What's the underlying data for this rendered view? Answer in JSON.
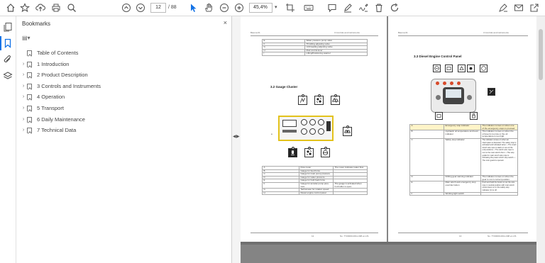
{
  "toolbar": {
    "current_page": "12",
    "total_pages": "/ 88",
    "zoom": "45,4%",
    "icons": [
      "home-icon",
      "star-icon",
      "upload-icon",
      "print-icon",
      "zoom-search-icon",
      "prev-page-icon",
      "next-page-icon",
      "select-cursor-icon",
      "hand-tool-icon",
      "zoom-out-icon",
      "zoom-in-icon",
      "crop-icon",
      "keyboard-icon",
      "comment-icon",
      "highlight-pen-icon",
      "sign-icon",
      "delete-icon",
      "rotate-icon",
      "redact-icon",
      "mail-icon",
      "share-icon"
    ]
  },
  "left_rail": {
    "icons": [
      "copy-pages-icon",
      "bookmark-icon",
      "attachment-icon",
      "layers-icon"
    ]
  },
  "bookmarks_panel": {
    "title": "Bookmarks",
    "close": "×",
    "options": "▤▾",
    "items": [
      {
        "label": "Table of Contents",
        "expandable": false
      },
      {
        "label": "1 Introduction",
        "expandable": true
      },
      {
        "label": "2 Product Description",
        "expandable": true
      },
      {
        "label": "3 Controls and Instruments",
        "expandable": true
      },
      {
        "label": "4 Operation",
        "expandable": true
      },
      {
        "label": "5 Transport",
        "expandable": true
      },
      {
        "label": "6 Daily Maintenance",
        "expandable": true
      },
      {
        "label": "7 Technical Data",
        "expandable": true
      }
    ]
  },
  "splitter": {
    "left_arrow": "◀",
    "right_arrow": "▶"
  },
  "page_left": {
    "header_left": "Bauma 01",
    "header_right": "3 Controls and instruments",
    "top_table": [
      [
        "E",
        "Water pressure pump valve"
      ],
      [
        "F",
        "Throttling adjusting valve"
      ],
      [
        "G",
        "Unthreading adjusting valve"
      ],
      [
        "H",
        "Mud control lever"
      ],
      [
        "I",
        "Lifting/Positioning swarrel"
      ]
    ],
    "section_title": "3.2   Gauge Cluster",
    "label_a": "a",
    "gauge_table": [
      [
        "A",
        "Flow meter",
        "The meter indicates water flow."
      ],
      [
        "B",
        "Gauge for feed force",
        ""
      ],
      [
        "C",
        "Gauge for main pump pressure",
        ""
      ],
      [
        "D",
        "Gauge for water pressure",
        ""
      ],
      [
        "E",
        "Gauge for hold back force",
        ""
      ],
      [
        "F",
        "Gauge for annular pump pres-sure",
        "The gauge is activated when hol-holder is open."
      ],
      [
        "G",
        "Tachometer for rotation speed",
        ""
      ],
      [
        "H",
        "Diesel engine control panel",
        ""
      ]
    ],
    "footer_left": "12",
    "footer_right": "No. TY00000-0011-008 en-US"
  },
  "page_right": {
    "header_left": "Bauma 01",
    "header_right": "3 Controls and instruments",
    "section_title": "3.3   Diesel Engine Control Panel",
    "ecp_table": [
      [
        "A",
        "Emergency stop indicator",
        "The indicator comes on when one of the emergency stops is pressed."
      ],
      [
        "B",
        "Hydraulic oil temperature and level indicator",
        "The indicator comes on when the oil level is too low or the oil temperature is too high."
      ],
      [
        "C",
        "Safety stop indicator",
        "The indicator comes on when an interruption is detected. The safety stop is activated and indicated when: • The crash winch wire rope is slack on one of the end positions. • The winch wire rope is out on the main winch drum. • The stop guide for main winch wire rope is activating the power winch stop switch. • The rotor guard is opened."
      ],
      [
        "D",
        "Drilling gear warning indicator",
        "The indicator comes on when the gear is not in correct position."
      ],
      [
        "E",
        "Main winch and emergency stop override button",
        "Push and hold the button to set the wire rope in neutral position with main winch control lever on in the safety stop indicator (C) is off."
      ],
      [
        "F",
        "Working light switch",
        ""
      ]
    ],
    "footer_left": "13",
    "footer_right": "No. TY00000-0011-008 en-US"
  }
}
